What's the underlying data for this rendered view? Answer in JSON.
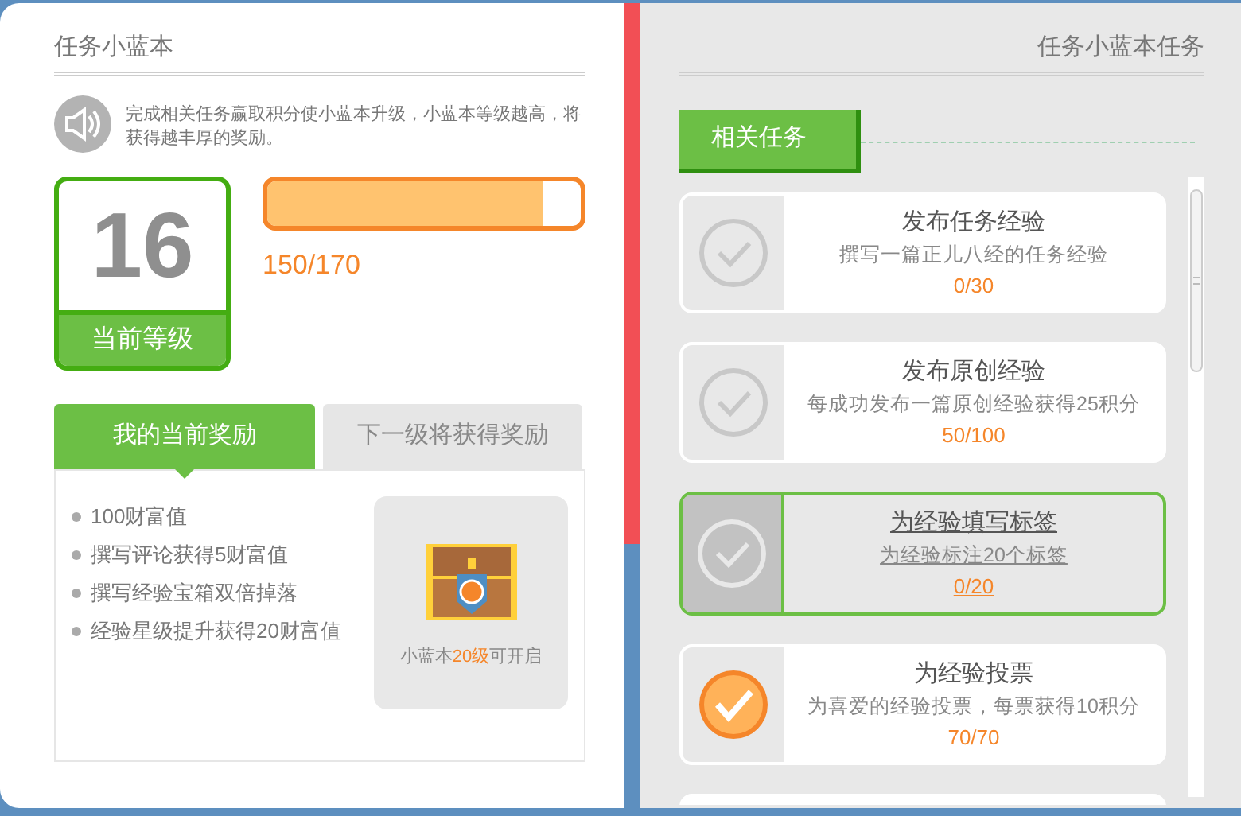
{
  "left": {
    "title": "任务小蓝本",
    "notice": "完成相关任务赢取积分使小蓝本升级，小蓝本等级越高，将获得越丰厚的奖励。",
    "level": {
      "value": "16",
      "label": "当前等级"
    },
    "progress": {
      "level": 0.88,
      "reading": "150/170"
    },
    "tabs": [
      {
        "label": "我的当前奖励",
        "selected": true
      },
      {
        "label": "下一级将获得奖励",
        "selected": false
      }
    ],
    "rewards": [
      "100财富值",
      "撰写评论获得5财富值",
      "撰写经验宝箱双倍掉落",
      "经验星级提升获得20财富值"
    ],
    "chest": {
      "caption": "小蓝本**20级**可开启"
    }
  },
  "right": {
    "title": "任务小蓝本任务",
    "section": "相关任务",
    "tasks": [
      {
        "title": "发布任务经验",
        "desc": "撰写一篇正儿八经的任务经验",
        "count": "0/30",
        "completed": false,
        "highlighted": false
      },
      {
        "title": "发布原创经验",
        "desc": "每成功发布一篇原创经验获得25积分",
        "count": "50/100",
        "completed": false,
        "highlighted": false
      },
      {
        "title": "为经验填写标签",
        "desc": "为经验标注20个标签",
        "count": "0/20",
        "completed": false,
        "highlighted": true
      },
      {
        "title": "为经验投票",
        "desc": "为喜爱的经验投票，每票获得10积分",
        "count": "70/70",
        "completed": true,
        "highlighted": false
      }
    ]
  }
}
